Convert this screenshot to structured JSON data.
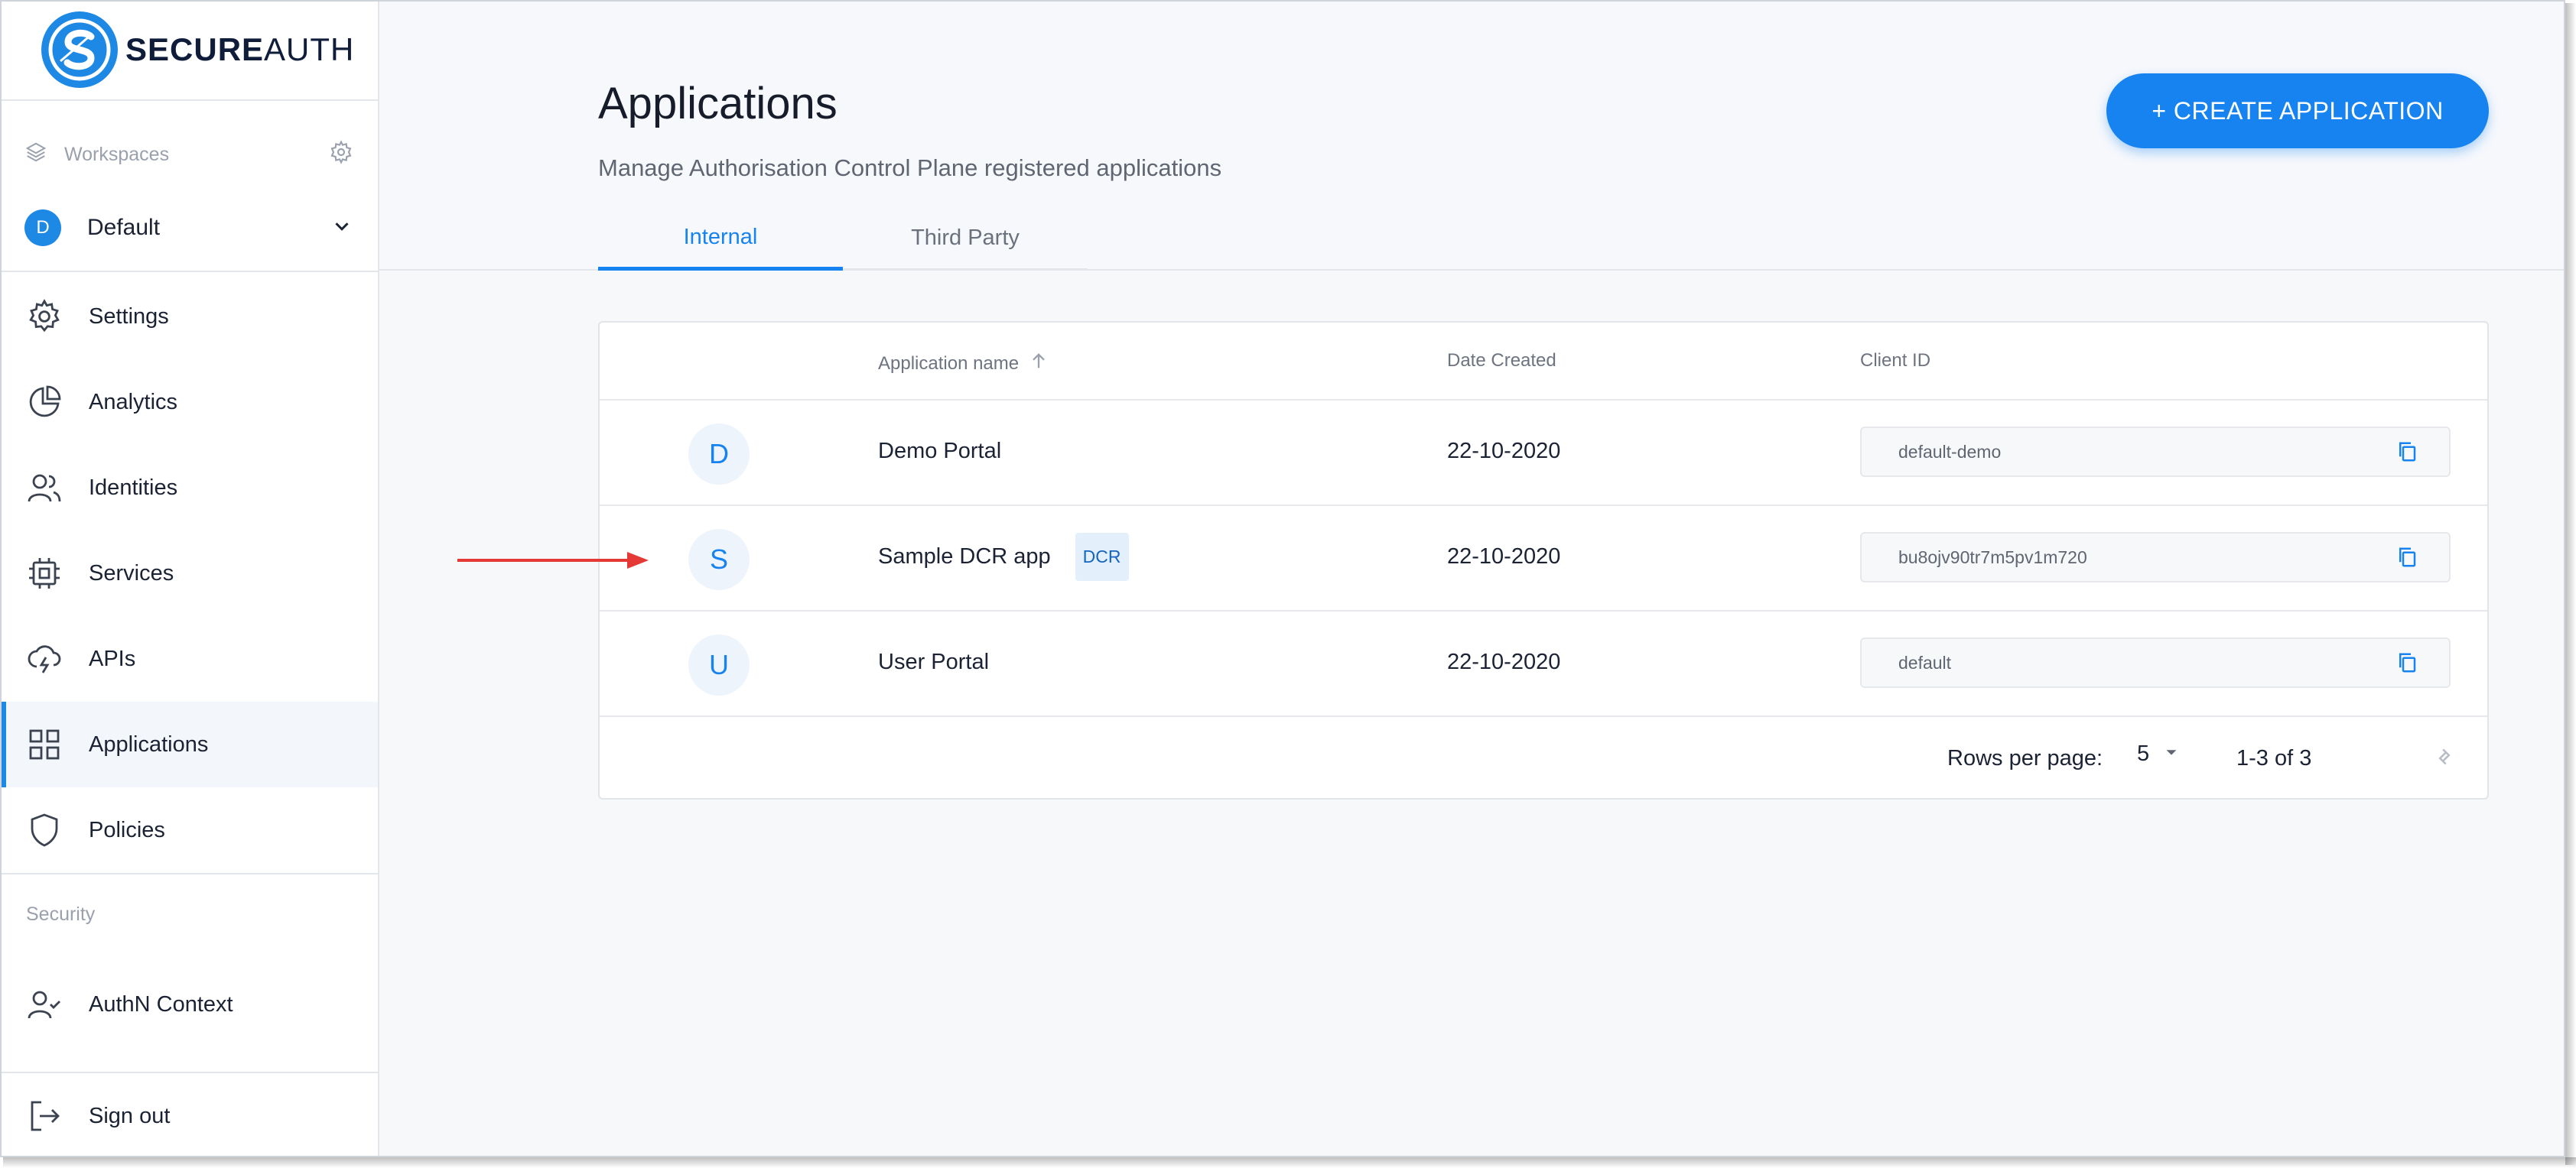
{
  "brand": {
    "name_bold": "SECURE",
    "name_thin": "AUTH"
  },
  "sidebar": {
    "workspaces_label": "Workspaces",
    "workspace": {
      "initial": "D",
      "name": "Default"
    },
    "items": [
      {
        "label": "Settings",
        "icon": "gear-icon"
      },
      {
        "label": "Analytics",
        "icon": "pie-chart-icon"
      },
      {
        "label": "Identities",
        "icon": "users-icon"
      },
      {
        "label": "Services",
        "icon": "chip-icon"
      },
      {
        "label": "APIs",
        "icon": "cloud-bolt-icon"
      },
      {
        "label": "Applications",
        "icon": "grid-icon",
        "active": true
      },
      {
        "label": "Policies",
        "icon": "shield-icon"
      }
    ],
    "security_label": "Security",
    "security_items": [
      {
        "label": "AuthN Context",
        "icon": "user-check-icon"
      }
    ],
    "sign_out": "Sign out"
  },
  "header": {
    "title": "Applications",
    "subtitle": "Manage Authorisation Control Plane registered applications",
    "create_button": "+ CREATE APPLICATION",
    "tabs": [
      {
        "label": "Internal",
        "active": true
      },
      {
        "label": "Third Party",
        "active": false
      }
    ]
  },
  "table": {
    "columns": {
      "name": "Application name",
      "date": "Date Created",
      "client": "Client ID"
    },
    "rows": [
      {
        "initial": "D",
        "name": "Demo Portal",
        "badge": "",
        "date": "22-10-2020",
        "client_id": "default-demo"
      },
      {
        "initial": "S",
        "name": "Sample DCR app",
        "badge": "DCR",
        "date": "22-10-2020",
        "client_id": "bu8ojv90tr7m5pv1m720"
      },
      {
        "initial": "U",
        "name": "User Portal",
        "badge": "",
        "date": "22-10-2020",
        "client_id": "default"
      }
    ],
    "footer": {
      "rows_per_page_label": "Rows per page:",
      "rows_per_page": "5",
      "range": "1-3 of 3"
    }
  },
  "colors": {
    "accent": "#1683f0",
    "arrow": "#e53935"
  }
}
